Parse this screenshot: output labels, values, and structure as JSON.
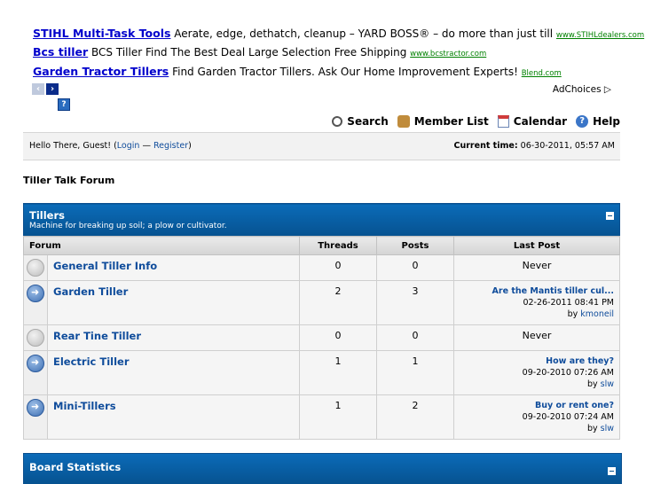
{
  "ads": [
    {
      "title": "STIHL Multi-Task Tools",
      "text": "Aerate, edge, dethatch, cleanup – YARD BOSS® – do more than just till",
      "url": "www.STIHLdealers.com"
    },
    {
      "title": "Bcs tiller",
      "text": "BCS Tiller Find The Best Deal Large Selection Free Shipping",
      "url": "www.bcstractor.com"
    },
    {
      "title": "Garden Tractor Tillers",
      "text": "Find Garden Tractor Tillers. Ask Our Home Improvement Experts!",
      "url": "Blend.com"
    }
  ],
  "adchoices": "AdChoices ▷",
  "menu": {
    "search": "Search",
    "members": "Member List",
    "calendar": "Calendar",
    "help": "Help"
  },
  "welcome": {
    "greeting": "Hello There, Guest! (",
    "login": "Login",
    "sep": " — ",
    "register": "Register",
    "close": ")",
    "time_label": "Current time:",
    "time_value": " 06-30-2011, 05:57 AM"
  },
  "forum_title": "Tiller Talk Forum",
  "category": {
    "title": "Tillers",
    "description": "Machine for breaking up soil; a plow or cultivator."
  },
  "columns": {
    "forum": "Forum",
    "threads": "Threads",
    "posts": "Posts",
    "last": "Last Post"
  },
  "forums": [
    {
      "name": "General Tiller Info",
      "threads": "0",
      "posts": "0",
      "status": "off",
      "never": "Never"
    },
    {
      "name": "Garden Tiller",
      "threads": "2",
      "posts": "3",
      "status": "on",
      "last_title": "Are the Mantis tiller cul...",
      "last_date": "02-26-2011 08:41 PM",
      "by": "by ",
      "author": "kmoneil"
    },
    {
      "name": "Rear Tine Tiller",
      "threads": "0",
      "posts": "0",
      "status": "off",
      "never": "Never"
    },
    {
      "name": "Electric Tiller",
      "threads": "1",
      "posts": "1",
      "status": "on",
      "last_title": "How are they?",
      "last_date": "09-20-2010 07:26 AM",
      "by": "by ",
      "author": "slw"
    },
    {
      "name": "Mini-Tillers",
      "threads": "1",
      "posts": "2",
      "status": "on",
      "last_title": "Buy or rent one?",
      "last_date": "09-20-2010 07:24 AM",
      "by": "by ",
      "author": "slw"
    }
  ],
  "stats": {
    "title": "Board Statistics"
  }
}
